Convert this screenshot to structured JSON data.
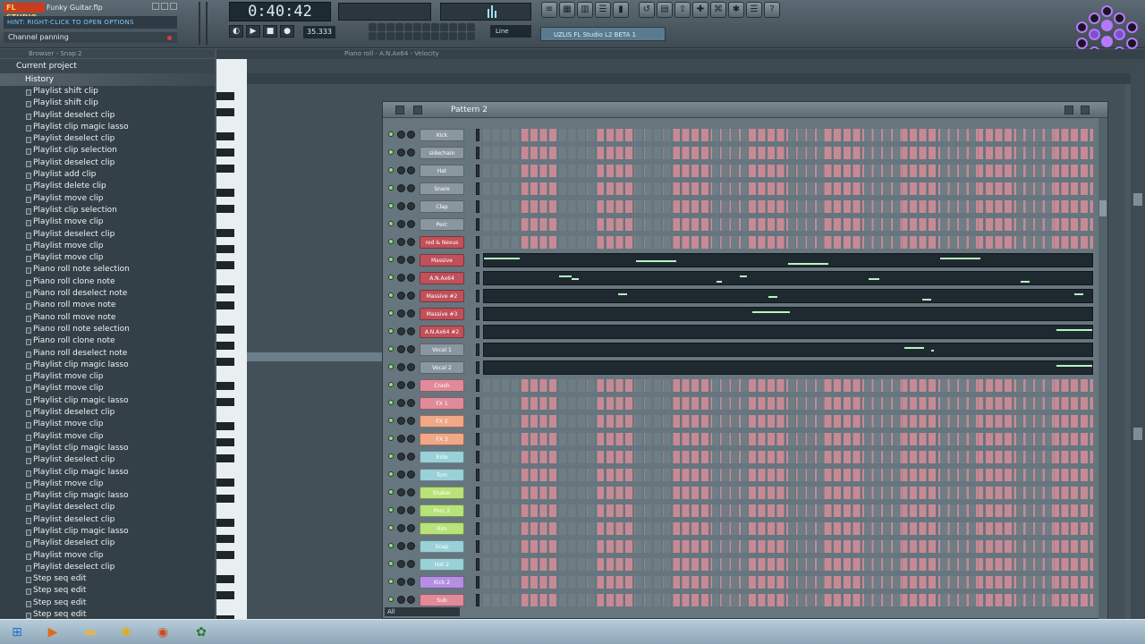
{
  "app": {
    "logo": "FL STUDIO",
    "song_name": "Funky Guitar.flp",
    "hint_text": "HINT: RIGHT-CLICK TO OPEN OPTIONS",
    "channel_hint": "Channel panning",
    "time": "0:40:42",
    "bpm": "35.333",
    "snap": "Line",
    "plugin_box": "UZLIS FL Studio L2 BETA 1"
  },
  "browser": {
    "header": "Browser - Snap 2",
    "current_project": "Current project",
    "history_label": "History",
    "history_items": [
      "Playlist shift clip",
      "Playlist shift clip",
      "Playlist deselect clip",
      "Playlist clip magic lasso",
      "Playlist deselect clip",
      "Playlist clip selection",
      "Playlist deselect clip",
      "Playlist add clip",
      "Playlist delete clip",
      "Playlist move clip",
      "Playlist clip selection",
      "Playlist move clip",
      "Playlist deselect clip",
      "Playlist move clip",
      "Playlist move clip",
      "Piano roll note selection",
      "Piano roll clone note",
      "Piano roll deselect note",
      "Piano roll move note",
      "Piano roll move note",
      "Piano roll note selection",
      "Piano roll clone note",
      "Piano roll deselect note",
      "Playlist clip magic lasso",
      "Playlist move clip",
      "Playlist move clip",
      "Playlist clip magic lasso",
      "Playlist deselect clip",
      "Playlist move clip",
      "Playlist move clip",
      "Playlist clip magic lasso",
      "Playlist deselect clip",
      "Playlist clip magic lasso",
      "Playlist move clip",
      "Playlist clip magic lasso",
      "Playlist deselect clip",
      "Playlist deselect clip",
      "Playlist clip magic lasso",
      "Playlist deselect clip",
      "Playlist move clip",
      "Playlist deselect clip",
      "Step seq edit",
      "Step seq edit",
      "Step seq edit",
      "Step seq edit"
    ]
  },
  "pianoroll": {
    "title": "Piano roll - A.N.Ax64 - Velocity"
  },
  "stepseq": {
    "pattern": "Pattern 2",
    "footer": "All",
    "channels": [
      {
        "name": "Kick",
        "color": "#8a97a0",
        "type": "steps"
      },
      {
        "name": "sidechain",
        "color": "#8a97a0",
        "type": "steps"
      },
      {
        "name": "Hat",
        "color": "#8a97a0",
        "type": "steps"
      },
      {
        "name": "Snare",
        "color": "#8a97a0",
        "type": "steps"
      },
      {
        "name": "Clap",
        "color": "#8a97a0",
        "type": "steps"
      },
      {
        "name": "Perc",
        "color": "#8a97a0",
        "type": "steps"
      },
      {
        "name": "red & Nexus",
        "color": "#c0505a",
        "type": "steps"
      },
      {
        "name": "Massive",
        "color": "#c0505a",
        "type": "roll"
      },
      {
        "name": "A.N.Ax64",
        "color": "#c0505a",
        "type": "roll"
      },
      {
        "name": "Massive #2",
        "color": "#c0505a",
        "type": "roll"
      },
      {
        "name": "Massive #3",
        "color": "#c0505a",
        "type": "roll"
      },
      {
        "name": "A.N.Ax64 #2",
        "color": "#c0505a",
        "type": "roll"
      },
      {
        "name": "Vocal 1",
        "color": "#8a97a0",
        "type": "roll"
      },
      {
        "name": "Vocal 2",
        "color": "#8a97a0",
        "type": "roll"
      },
      {
        "name": "Crash",
        "color": "#e08a9a",
        "type": "steps"
      },
      {
        "name": "FX 1",
        "color": "#e08a9a",
        "type": "steps"
      },
      {
        "name": "FX 2",
        "color": "#f0a888",
        "type": "steps"
      },
      {
        "name": "FX 3",
        "color": "#f0a888",
        "type": "steps"
      },
      {
        "name": "Ride",
        "color": "#9ad0d8",
        "type": "steps"
      },
      {
        "name": "Tom",
        "color": "#9ad0d8",
        "type": "steps"
      },
      {
        "name": "Shaker",
        "color": "#b8e27a",
        "type": "steps"
      },
      {
        "name": "Perc 2",
        "color": "#b8e27a",
        "type": "steps"
      },
      {
        "name": "Rim",
        "color": "#b8e27a",
        "type": "steps"
      },
      {
        "name": "Snap",
        "color": "#9ad0d8",
        "type": "steps"
      },
      {
        "name": "Hat 2",
        "color": "#9ad0d8",
        "type": "steps"
      },
      {
        "name": "Kick 2",
        "color": "#b48ee0",
        "type": "steps"
      },
      {
        "name": "Sub",
        "color": "#e08a9a",
        "type": "steps"
      }
    ]
  },
  "taskbar": {
    "icons": [
      "windows-start-icon",
      "media-player-icon",
      "folder-icon",
      "fl-studio-icon",
      "firefox-icon",
      "fl-taskbar-icon"
    ]
  }
}
